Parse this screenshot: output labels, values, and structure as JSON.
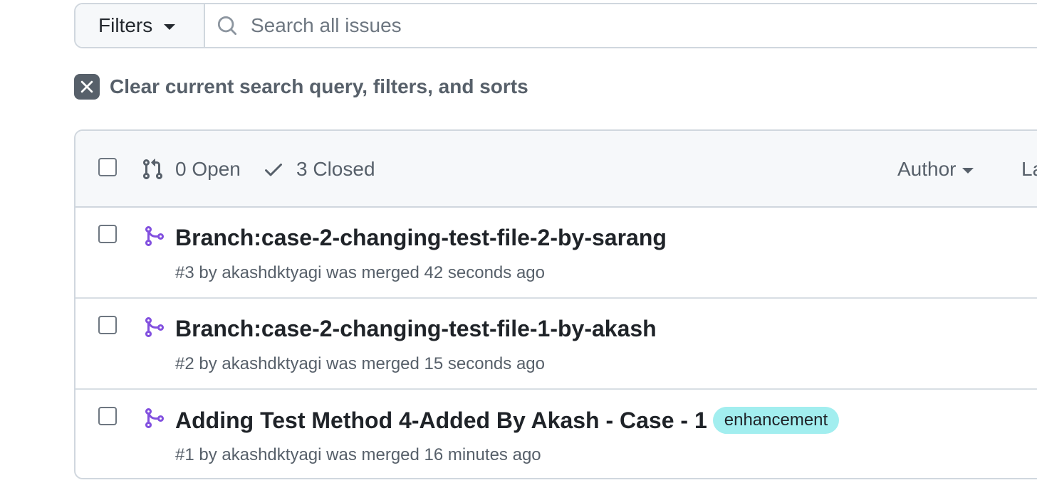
{
  "filters": {
    "label": "Filters"
  },
  "search": {
    "placeholder": "Search all issues"
  },
  "clear": {
    "label": "Clear current search query, filters, and sorts"
  },
  "header": {
    "open_label": "0 Open",
    "closed_label": "3 Closed",
    "author_label": "Author",
    "label_partial": "La"
  },
  "pull_requests": [
    {
      "title": "Branch:case-2-changing-test-file-2-by-sarang",
      "meta": "#3 by akashdktyagi was merged 42 seconds ago",
      "label": ""
    },
    {
      "title": "Branch:case-2-changing-test-file-1-by-akash",
      "meta": "#2 by akashdktyagi was merged 15 seconds ago",
      "label": ""
    },
    {
      "title": "Adding Test Method 4-Added By Akash - Case - 1",
      "meta": "#1 by akashdktyagi was merged 16 minutes ago",
      "label": "enhancement"
    }
  ],
  "colors": {
    "merged": "#8250df",
    "label_bg": "#a2eeef",
    "muted": "#57606a"
  }
}
